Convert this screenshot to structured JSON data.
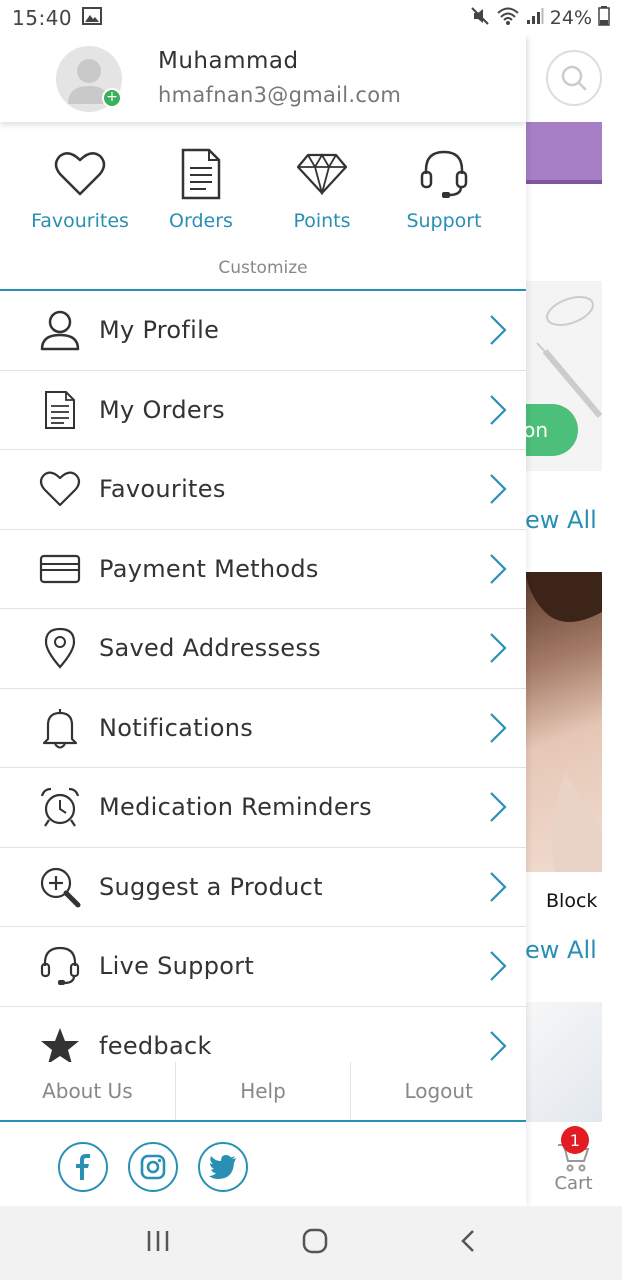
{
  "status_bar": {
    "time": "15:40",
    "battery": "24%"
  },
  "user": {
    "name": "Muhammad",
    "email": "hmafnan3@gmail.com"
  },
  "quick_links": [
    {
      "label": "Favourites",
      "icon": "heart-icon"
    },
    {
      "label": "Orders",
      "icon": "document-icon"
    },
    {
      "label": "Points",
      "icon": "diamond-icon"
    },
    {
      "label": "Support",
      "icon": "headset-icon"
    }
  ],
  "customize_label": "Customize",
  "menu": [
    {
      "label": "My Profile",
      "icon": "person-icon"
    },
    {
      "label": "My Orders",
      "icon": "document-icon"
    },
    {
      "label": "Favourites",
      "icon": "heart-icon"
    },
    {
      "label": "Payment Methods",
      "icon": "credit-card-icon"
    },
    {
      "label": "Saved Addressess",
      "icon": "location-pin-icon"
    },
    {
      "label": "Notifications",
      "icon": "bell-icon"
    },
    {
      "label": "Medication Reminders",
      "icon": "alarm-clock-icon"
    },
    {
      "label": "Suggest a Product",
      "icon": "search-plus-icon"
    },
    {
      "label": "Live Support",
      "icon": "headset-icon"
    },
    {
      "label": "feedback",
      "icon": "star-icon"
    }
  ],
  "footer_links": [
    "About Us",
    "Help",
    "Logout"
  ],
  "social": [
    "facebook-icon",
    "instagram-icon",
    "twitter-icon"
  ],
  "background": {
    "button_partial": "on",
    "view_all_1": "ew All",
    "product_partial": "Block",
    "view_all_2": "ew All",
    "cart_label": "Cart",
    "cart_count": "1"
  },
  "colors": {
    "accent": "#2a8fb5",
    "badge": "#e31b23",
    "green": "#4cc07a",
    "banner": "#a67fc6"
  }
}
